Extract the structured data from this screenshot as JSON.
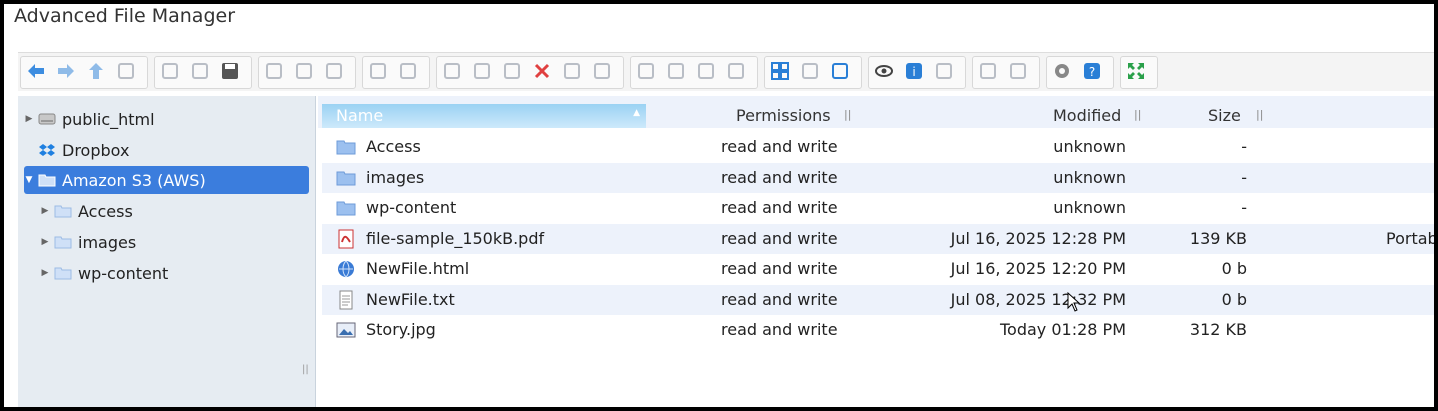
{
  "app": {
    "title": "Advanced File Manager"
  },
  "toolbar": {
    "icons": [
      "back-icon",
      "forward-icon",
      "up-icon",
      "reload-icon",
      "new-folder-icon",
      "new-file-icon",
      "save-icon",
      "open-icon",
      "save-as-icon",
      "select-icon",
      "undo-icon",
      "redo-icon",
      "copy-icon",
      "cut-icon",
      "paste-icon",
      "delete-icon",
      "empty-icon",
      "duplicate-icon",
      "rename-icon",
      "select-all-icon",
      "edit-icon",
      "upload-icon",
      "view-icons-icon",
      "view-list-icon",
      "view-details-icon",
      "preview-icon",
      "info-icon",
      "extract-icon",
      "archive-icon",
      "resize-icon",
      "settings-icon",
      "help-icon",
      "fullscreen-icon"
    ]
  },
  "nav": {
    "items": [
      {
        "label": "public_html",
        "icon": "drive-icon"
      },
      {
        "label": "Dropbox",
        "icon": "dropbox-icon"
      },
      {
        "label": "Amazon S3 (AWS)",
        "icon": "folder-open-icon"
      },
      {
        "label": "Access",
        "icon": "folder-icon"
      },
      {
        "label": "images",
        "icon": "folder-icon"
      },
      {
        "label": "wp-content",
        "icon": "folder-icon"
      }
    ],
    "resize_handle": "||"
  },
  "list": {
    "columns": {
      "name": "Name",
      "permissions": "Permissions",
      "modified": "Modified",
      "size": "Size"
    },
    "rows": [
      {
        "name": "Access",
        "permissions": "read and write",
        "modified": "unknown",
        "size": "-",
        "kind": "",
        "icon": "folder-icon"
      },
      {
        "name": "images",
        "permissions": "read and write",
        "modified": "unknown",
        "size": "-",
        "kind": "",
        "icon": "folder-icon"
      },
      {
        "name": "wp-content",
        "permissions": "read and write",
        "modified": "unknown",
        "size": "-",
        "kind": "",
        "icon": "folder-icon"
      },
      {
        "name": "file-sample_150kB.pdf",
        "permissions": "read and write",
        "modified": "Jul 16, 2025 12:28 PM",
        "size": "139 KB",
        "kind": "Portab",
        "icon": "pdf-icon"
      },
      {
        "name": "NewFile.html",
        "permissions": "read and write",
        "modified": "Jul 16, 2025 12:20 PM",
        "size": "0 b",
        "kind": "",
        "icon": "html-icon"
      },
      {
        "name": "NewFile.txt",
        "permissions": "read and write",
        "modified": "Jul 08, 2025 12:32 PM",
        "size": "0 b",
        "kind": "",
        "icon": "text-file-icon"
      },
      {
        "name": "Story.jpg",
        "permissions": "read and write",
        "modified": "Today 01:28 PM",
        "size": "312 KB",
        "kind": "",
        "icon": "image-icon"
      }
    ]
  },
  "colors": {
    "selected": "#3b7ddd",
    "header": "#edf2fb",
    "nav_bg": "#e6ecf2",
    "folder": "#8fb5ea"
  }
}
